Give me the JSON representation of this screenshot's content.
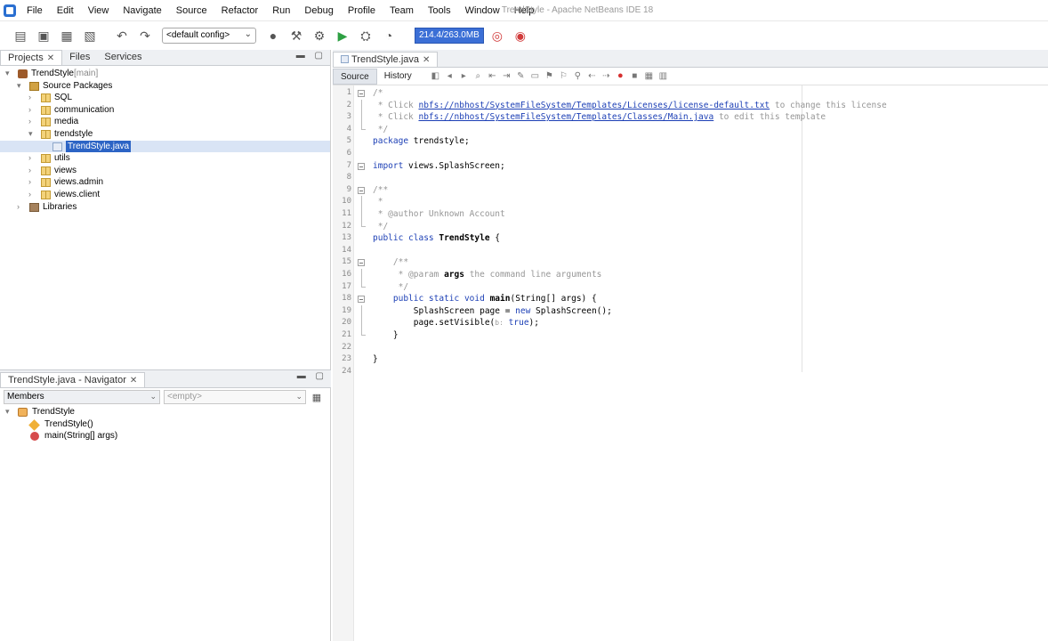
{
  "window": {
    "title": "TrendStyle - Apache NetBeans IDE 18"
  },
  "menu": [
    "File",
    "Edit",
    "View",
    "Navigate",
    "Source",
    "Refactor",
    "Run",
    "Debug",
    "Profile",
    "Team",
    "Tools",
    "Window",
    "Help"
  ],
  "toolbar": {
    "config": "<default config>",
    "memory": "214.4/263.0MB"
  },
  "projects": {
    "tabs": [
      "Projects",
      "Files",
      "Services"
    ],
    "tree": [
      {
        "label": "TrendStyle",
        "suffix": "[main]",
        "icon": "project-icon",
        "depth": 0,
        "toggle": "▾"
      },
      {
        "label": "Source Packages",
        "icon": "source-packages-icon",
        "depth": 1,
        "toggle": "▾"
      },
      {
        "label": "SQL",
        "icon": "package-icon",
        "depth": 2,
        "toggle": "›"
      },
      {
        "label": "communication",
        "icon": "package-icon",
        "depth": 2,
        "toggle": "›"
      },
      {
        "label": "media",
        "icon": "package-icon",
        "depth": 2,
        "toggle": "›"
      },
      {
        "label": "trendstyle",
        "icon": "package-icon",
        "depth": 2,
        "toggle": "▾"
      },
      {
        "label": "TrendStyle.java",
        "icon": "java-file-icon",
        "depth": 3,
        "toggle": "",
        "selected": true
      },
      {
        "label": "utils",
        "icon": "package-icon",
        "depth": 2,
        "toggle": "›"
      },
      {
        "label": "views",
        "icon": "package-icon",
        "depth": 2,
        "toggle": "›"
      },
      {
        "label": "views.admin",
        "icon": "package-icon",
        "depth": 2,
        "toggle": "›"
      },
      {
        "label": "views.client",
        "icon": "package-icon",
        "depth": 2,
        "toggle": "›"
      },
      {
        "label": "Libraries",
        "icon": "libraries-icon",
        "depth": 1,
        "toggle": "›"
      }
    ]
  },
  "navigator": {
    "tab": "TrendStyle.java - Navigator",
    "filter": "Members",
    "empty": "<empty>",
    "tree": [
      {
        "label": "TrendStyle",
        "icon": "class-icon",
        "depth": 0
      },
      {
        "label": "TrendStyle()",
        "icon": "constructor-icon",
        "depth": 1
      },
      {
        "label": "main(String[] args)",
        "icon": "method-icon",
        "depth": 1
      }
    ]
  },
  "editor": {
    "tab": "TrendStyle.java",
    "view_tabs": [
      "Source",
      "History"
    ],
    "lines": [
      {
        "n": "1",
        "fold": "start",
        "html": "<span class='c'>/*</span>"
      },
      {
        "n": "2",
        "fold": "line",
        "html": "<span class='c'> * Click </span><span class='u'>nbfs://nbhost/SystemFileSystem/Templates/Licenses/license-default.txt</span><span class='c'> to change this license</span>"
      },
      {
        "n": "3",
        "fold": "line",
        "html": "<span class='c'> * Click </span><span class='u'>nbfs://nbhost/SystemFileSystem/Templates/Classes/Main.java</span><span class='c'> to edit this template</span>"
      },
      {
        "n": "4",
        "fold": "end",
        "html": "<span class='c'> */</span>"
      },
      {
        "n": "5",
        "fold": "",
        "html": "<span class='k'>package</span> trendstyle;"
      },
      {
        "n": "6",
        "fold": "",
        "html": ""
      },
      {
        "n": "7",
        "fold": "start",
        "html": "<span class='k'>import</span> views.SplashScreen;"
      },
      {
        "n": "8",
        "fold": "",
        "html": ""
      },
      {
        "n": "9",
        "fold": "start",
        "html": "<span class='c'>/**</span>"
      },
      {
        "n": "10",
        "fold": "line",
        "html": "<span class='c'> *</span>"
      },
      {
        "n": "11",
        "fold": "line",
        "html": "<span class='c'> * @author Unknown Account</span>"
      },
      {
        "n": "12",
        "fold": "end",
        "html": "<span class='c'> */</span>"
      },
      {
        "n": "13",
        "fold": "",
        "html": "<span class='k'>public class</span> <span class='b'>TrendStyle</span> {"
      },
      {
        "n": "14",
        "fold": "",
        "html": ""
      },
      {
        "n": "15",
        "fold": "start",
        "html": "    <span class='c'>/**</span>"
      },
      {
        "n": "16",
        "fold": "line",
        "html": "<span class='c'>     * @param </span><span class='b'>args</span><span class='c'> the command line arguments</span>"
      },
      {
        "n": "17",
        "fold": "end",
        "html": "<span class='c'>     */</span>"
      },
      {
        "n": "18",
        "fold": "start",
        "html": "    <span class='k'>public static void</span> <span class='b'>main</span>(String[] args) {"
      },
      {
        "n": "19",
        "fold": "line",
        "html": "        SplashScreen page = <span class='k'>new</span> SplashScreen();"
      },
      {
        "n": "20",
        "fold": "line",
        "html": "        page.setVisible(<span class='hint'>b:</span> <span class='k'>true</span>);"
      },
      {
        "n": "21",
        "fold": "end",
        "html": "    }"
      },
      {
        "n": "22",
        "fold": "",
        "html": ""
      },
      {
        "n": "23",
        "fold": "",
        "html": "}"
      },
      {
        "n": "24",
        "fold": "",
        "html": ""
      }
    ]
  }
}
